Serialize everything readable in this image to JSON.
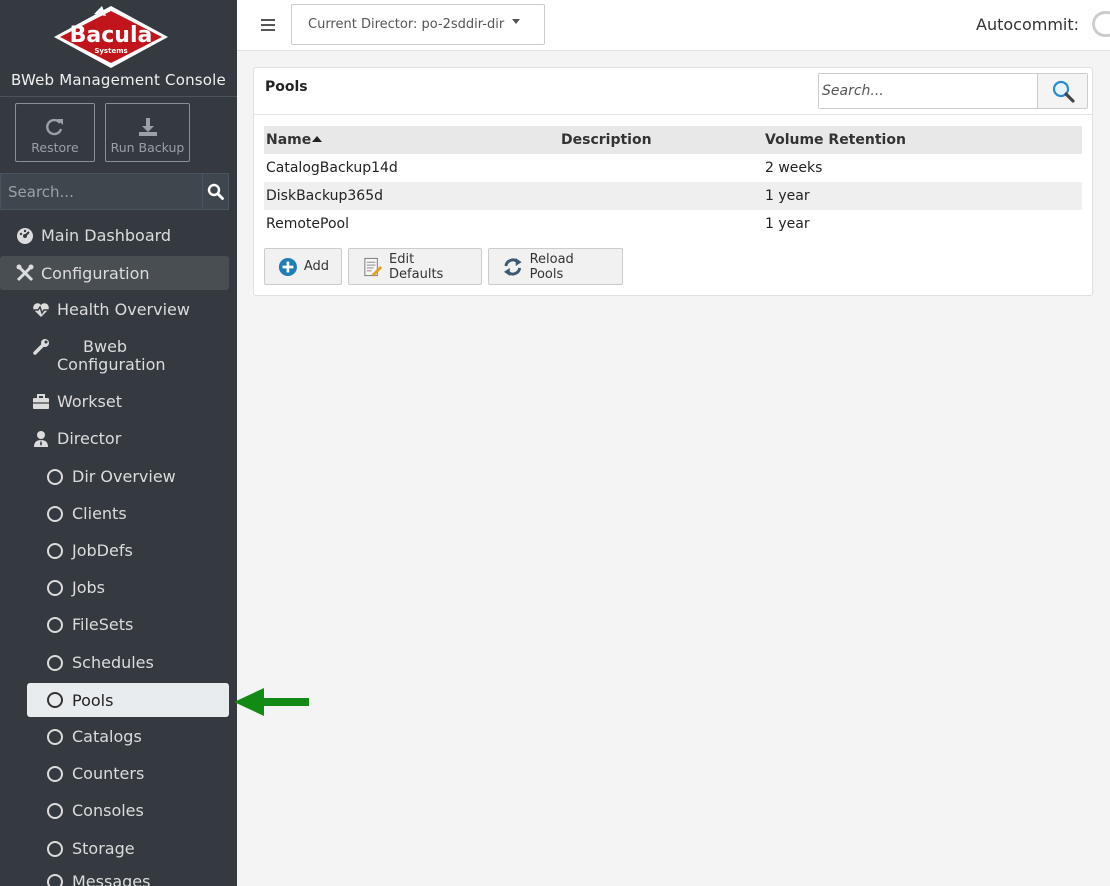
{
  "brand": {
    "logo_text": "Bacula",
    "logo_subtext": "Systems",
    "title": "BWeb Management Console"
  },
  "quick_actions": {
    "restore": "Restore",
    "run_backup": "Run Backup"
  },
  "sidebar_search": {
    "placeholder": "Search..."
  },
  "nav": {
    "main_dashboard": "Main Dashboard",
    "configuration": "Configuration",
    "health_overview": "Health Overview",
    "bweb_configuration": "Bweb Configuration",
    "workset": "Workset",
    "director": "Director",
    "director_items": [
      "Dir Overview",
      "Clients",
      "JobDefs",
      "Jobs",
      "FileSets",
      "Schedules",
      "Pools",
      "Catalogs",
      "Counters",
      "Consoles",
      "Storage",
      "Messages"
    ],
    "selected": "Pools"
  },
  "topbar": {
    "director_label": "Current Director: po-2sddir-dir",
    "autocommit_label": "Autocommit:"
  },
  "panel": {
    "title": "Pools",
    "search_placeholder": "Search...",
    "columns": {
      "name": "Name",
      "description": "Description",
      "volume_retention": "Volume Retention"
    },
    "rows": [
      {
        "name": "CatalogBackup14d",
        "description": "",
        "volume_retention": "2 weeks"
      },
      {
        "name": "DiskBackup365d",
        "description": "",
        "volume_retention": "1 year"
      },
      {
        "name": "RemotePool",
        "description": "",
        "volume_retention": "1 year"
      }
    ],
    "buttons": {
      "add": "Add",
      "edit_defaults": "Edit Defaults",
      "reload_pools": "Reload Pools"
    }
  },
  "colors": {
    "sidebar_bg": "#343a40",
    "annotation_arrow": "#138a13",
    "add_icon": "#1e7fb6"
  }
}
